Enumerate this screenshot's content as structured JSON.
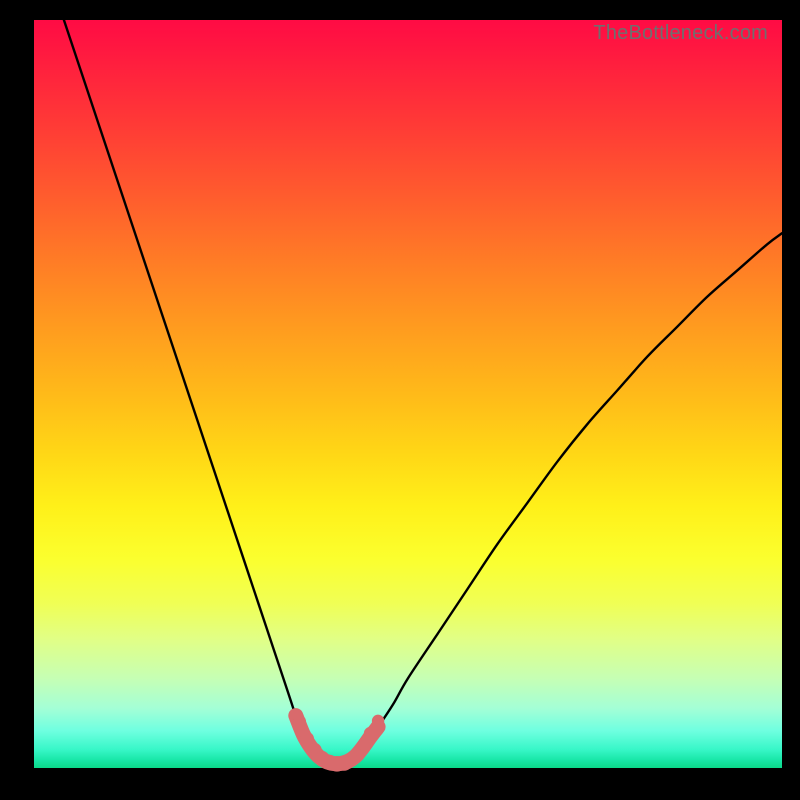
{
  "watermark": "TheBottleneck.com",
  "colors": {
    "trough_stroke": "#d96a6c",
    "curve_stroke": "#000000",
    "dot_fill": "#d96a6c"
  },
  "chart_data": {
    "type": "line",
    "title": "",
    "xlabel": "",
    "ylabel": "",
    "xlim": [
      0,
      100
    ],
    "ylim": [
      0,
      100
    ],
    "grid": false,
    "legend": false,
    "series": [
      {
        "name": "bottleneck-curve",
        "x": [
          4,
          6,
          8,
          10,
          12,
          14,
          16,
          18,
          20,
          22,
          24,
          26,
          28,
          30,
          32,
          34,
          35,
          36,
          37,
          38,
          39,
          40,
          41,
          42,
          43,
          44,
          46,
          48,
          50,
          54,
          58,
          62,
          66,
          70,
          74,
          78,
          82,
          86,
          90,
          94,
          98,
          100
        ],
        "y": [
          100,
          94,
          88,
          82,
          76,
          70,
          64,
          58,
          52,
          46,
          40,
          34,
          28,
          22,
          16,
          10,
          7,
          4.5,
          2.8,
          1.6,
          0.9,
          0.6,
          0.6,
          0.9,
          1.6,
          2.8,
          5.5,
          8.5,
          12,
          18,
          24,
          30,
          35.5,
          41,
          46,
          50.5,
          55,
          59,
          63,
          66.5,
          70,
          71.5
        ]
      }
    ],
    "trough_segment": {
      "name": "highlighted-trough",
      "x": [
        35.0,
        36.0,
        37.0,
        38.0,
        39.0,
        40.0,
        41.0,
        42.0,
        43.0,
        44.0,
        45.0,
        46.0
      ],
      "y": [
        7.0,
        4.5,
        2.8,
        1.6,
        0.9,
        0.6,
        0.6,
        0.9,
        1.6,
        2.8,
        4.2,
        5.5
      ]
    },
    "trough_dots": {
      "x": [
        35.5,
        36.5,
        37.5,
        38.5,
        39.5,
        40.5,
        41.5,
        43.3,
        44.3,
        45.0,
        46.0
      ],
      "y": [
        6.2,
        3.9,
        2.4,
        1.3,
        0.75,
        0.55,
        0.65,
        1.8,
        3.2,
        4.6,
        6.3
      ],
      "r": [
        6.5,
        7.0,
        7.2,
        7.4,
        7.6,
        7.8,
        7.6,
        7.0,
        7.2,
        6.8,
        6.2
      ]
    }
  }
}
